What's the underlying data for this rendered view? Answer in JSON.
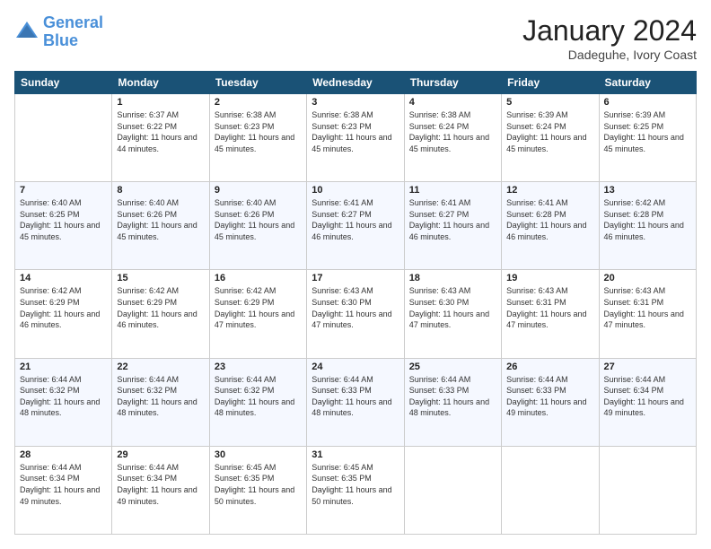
{
  "header": {
    "logo_line1": "General",
    "logo_line2": "Blue",
    "month": "January 2024",
    "location": "Dadeguhe, Ivory Coast"
  },
  "weekdays": [
    "Sunday",
    "Monday",
    "Tuesday",
    "Wednesday",
    "Thursday",
    "Friday",
    "Saturday"
  ],
  "weeks": [
    [
      {
        "day": "",
        "empty": true
      },
      {
        "day": "1",
        "sunrise": "6:37 AM",
        "sunset": "6:22 PM",
        "daylight": "11 hours and 44 minutes."
      },
      {
        "day": "2",
        "sunrise": "6:38 AM",
        "sunset": "6:23 PM",
        "daylight": "11 hours and 45 minutes."
      },
      {
        "day": "3",
        "sunrise": "6:38 AM",
        "sunset": "6:23 PM",
        "daylight": "11 hours and 45 minutes."
      },
      {
        "day": "4",
        "sunrise": "6:38 AM",
        "sunset": "6:24 PM",
        "daylight": "11 hours and 45 minutes."
      },
      {
        "day": "5",
        "sunrise": "6:39 AM",
        "sunset": "6:24 PM",
        "daylight": "11 hours and 45 minutes."
      },
      {
        "day": "6",
        "sunrise": "6:39 AM",
        "sunset": "6:25 PM",
        "daylight": "11 hours and 45 minutes."
      }
    ],
    [
      {
        "day": "7",
        "sunrise": "6:40 AM",
        "sunset": "6:25 PM",
        "daylight": "11 hours and 45 minutes."
      },
      {
        "day": "8",
        "sunrise": "6:40 AM",
        "sunset": "6:26 PM",
        "daylight": "11 hours and 45 minutes."
      },
      {
        "day": "9",
        "sunrise": "6:40 AM",
        "sunset": "6:26 PM",
        "daylight": "11 hours and 45 minutes."
      },
      {
        "day": "10",
        "sunrise": "6:41 AM",
        "sunset": "6:27 PM",
        "daylight": "11 hours and 46 minutes."
      },
      {
        "day": "11",
        "sunrise": "6:41 AM",
        "sunset": "6:27 PM",
        "daylight": "11 hours and 46 minutes."
      },
      {
        "day": "12",
        "sunrise": "6:41 AM",
        "sunset": "6:28 PM",
        "daylight": "11 hours and 46 minutes."
      },
      {
        "day": "13",
        "sunrise": "6:42 AM",
        "sunset": "6:28 PM",
        "daylight": "11 hours and 46 minutes."
      }
    ],
    [
      {
        "day": "14",
        "sunrise": "6:42 AM",
        "sunset": "6:29 PM",
        "daylight": "11 hours and 46 minutes."
      },
      {
        "day": "15",
        "sunrise": "6:42 AM",
        "sunset": "6:29 PM",
        "daylight": "11 hours and 46 minutes."
      },
      {
        "day": "16",
        "sunrise": "6:42 AM",
        "sunset": "6:29 PM",
        "daylight": "11 hours and 47 minutes."
      },
      {
        "day": "17",
        "sunrise": "6:43 AM",
        "sunset": "6:30 PM",
        "daylight": "11 hours and 47 minutes."
      },
      {
        "day": "18",
        "sunrise": "6:43 AM",
        "sunset": "6:30 PM",
        "daylight": "11 hours and 47 minutes."
      },
      {
        "day": "19",
        "sunrise": "6:43 AM",
        "sunset": "6:31 PM",
        "daylight": "11 hours and 47 minutes."
      },
      {
        "day": "20",
        "sunrise": "6:43 AM",
        "sunset": "6:31 PM",
        "daylight": "11 hours and 47 minutes."
      }
    ],
    [
      {
        "day": "21",
        "sunrise": "6:44 AM",
        "sunset": "6:32 PM",
        "daylight": "11 hours and 48 minutes."
      },
      {
        "day": "22",
        "sunrise": "6:44 AM",
        "sunset": "6:32 PM",
        "daylight": "11 hours and 48 minutes."
      },
      {
        "day": "23",
        "sunrise": "6:44 AM",
        "sunset": "6:32 PM",
        "daylight": "11 hours and 48 minutes."
      },
      {
        "day": "24",
        "sunrise": "6:44 AM",
        "sunset": "6:33 PM",
        "daylight": "11 hours and 48 minutes."
      },
      {
        "day": "25",
        "sunrise": "6:44 AM",
        "sunset": "6:33 PM",
        "daylight": "11 hours and 48 minutes."
      },
      {
        "day": "26",
        "sunrise": "6:44 AM",
        "sunset": "6:33 PM",
        "daylight": "11 hours and 49 minutes."
      },
      {
        "day": "27",
        "sunrise": "6:44 AM",
        "sunset": "6:34 PM",
        "daylight": "11 hours and 49 minutes."
      }
    ],
    [
      {
        "day": "28",
        "sunrise": "6:44 AM",
        "sunset": "6:34 PM",
        "daylight": "11 hours and 49 minutes."
      },
      {
        "day": "29",
        "sunrise": "6:44 AM",
        "sunset": "6:34 PM",
        "daylight": "11 hours and 49 minutes."
      },
      {
        "day": "30",
        "sunrise": "6:45 AM",
        "sunset": "6:35 PM",
        "daylight": "11 hours and 50 minutes."
      },
      {
        "day": "31",
        "sunrise": "6:45 AM",
        "sunset": "6:35 PM",
        "daylight": "11 hours and 50 minutes."
      },
      {
        "day": "",
        "empty": true
      },
      {
        "day": "",
        "empty": true
      },
      {
        "day": "",
        "empty": true
      }
    ]
  ],
  "labels": {
    "sunrise": "Sunrise:",
    "sunset": "Sunset:",
    "daylight": "Daylight:"
  }
}
